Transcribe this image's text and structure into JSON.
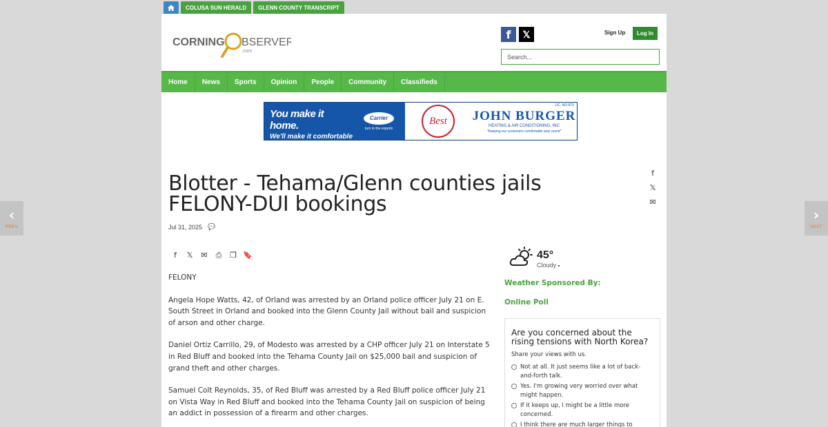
{
  "site_tabs": {
    "home_icon": "home-icon",
    "tab1": "COLUSA SUN HERALD",
    "tab2": "GLENN COUNTY TRANSCRIPT"
  },
  "header": {
    "logo_text_a": "CORNING",
    "logo_text_o": "O",
    "logo_text_b": "BSERVER",
    "logo_sub": ".com",
    "sign_up": "Sign Up",
    "log_in": "Log In",
    "search_placeholder": "Search..."
  },
  "nav": [
    "Home",
    "News",
    "Sports",
    "Opinion",
    "People",
    "Community",
    "Classifieds"
  ],
  "ad": {
    "line1": "You make it home.",
    "line2": "We'll make it comfortable",
    "carrier": "Carrier",
    "carrier_tag": "turn to the experts",
    "best": "Best",
    "company": "JOHN BURGER",
    "company_sub": "HEATING & AIR CONDITIONING, INC",
    "tagline": "\"Keeping our customers comfortable year round\"",
    "license": "LIC. NO.870"
  },
  "article": {
    "title": "Blotter - Tehama/Glenn counties jails FELONY-DUI bookings",
    "date": "Jul 31, 2025",
    "paragraphs": [
      "FELONY",
      "Angela Hope Watts, 42, of Orland was arrested by an Orland police officer July 21 on E. South Street in Orland and booked into the Glenn County Jail without bail and suspicion of arson and other charge.",
      "Daniel Ortiz Carrillo, 29, of Modesto was arrested by a CHP officer July 21 on Interstate 5 in Red Bluff and booked into the Tehama County Jail on $25,000 bail and suspicion of grand theft and other charges.",
      "Samuel Colt Reynolds, 35, of Red Bluff was arrested by a Red Bluff police officer July 21 on Vista Way in Red Bluff and booked into the Tehama County Jail on suspicion of being an addict in possession of a firearm and other charges."
    ]
  },
  "weather": {
    "temp": "45°",
    "condition": "Cloudy",
    "sponsor": "Weather Sponsored By:"
  },
  "poll": {
    "heading": "Online Poll",
    "question": "Are you concerned about the rising tensions with North Korea?",
    "sub": "Share your views with us.",
    "options": [
      "Not at all. It just seems like a lot of back-and-forth talk.",
      "Yes. I'm growing very worried over what might happen.",
      "If it keeps up, I might be a little more concerned.",
      "I think there are much larger things to concern"
    ]
  },
  "pager": {
    "prev": "PREV",
    "next": "NEXT"
  }
}
